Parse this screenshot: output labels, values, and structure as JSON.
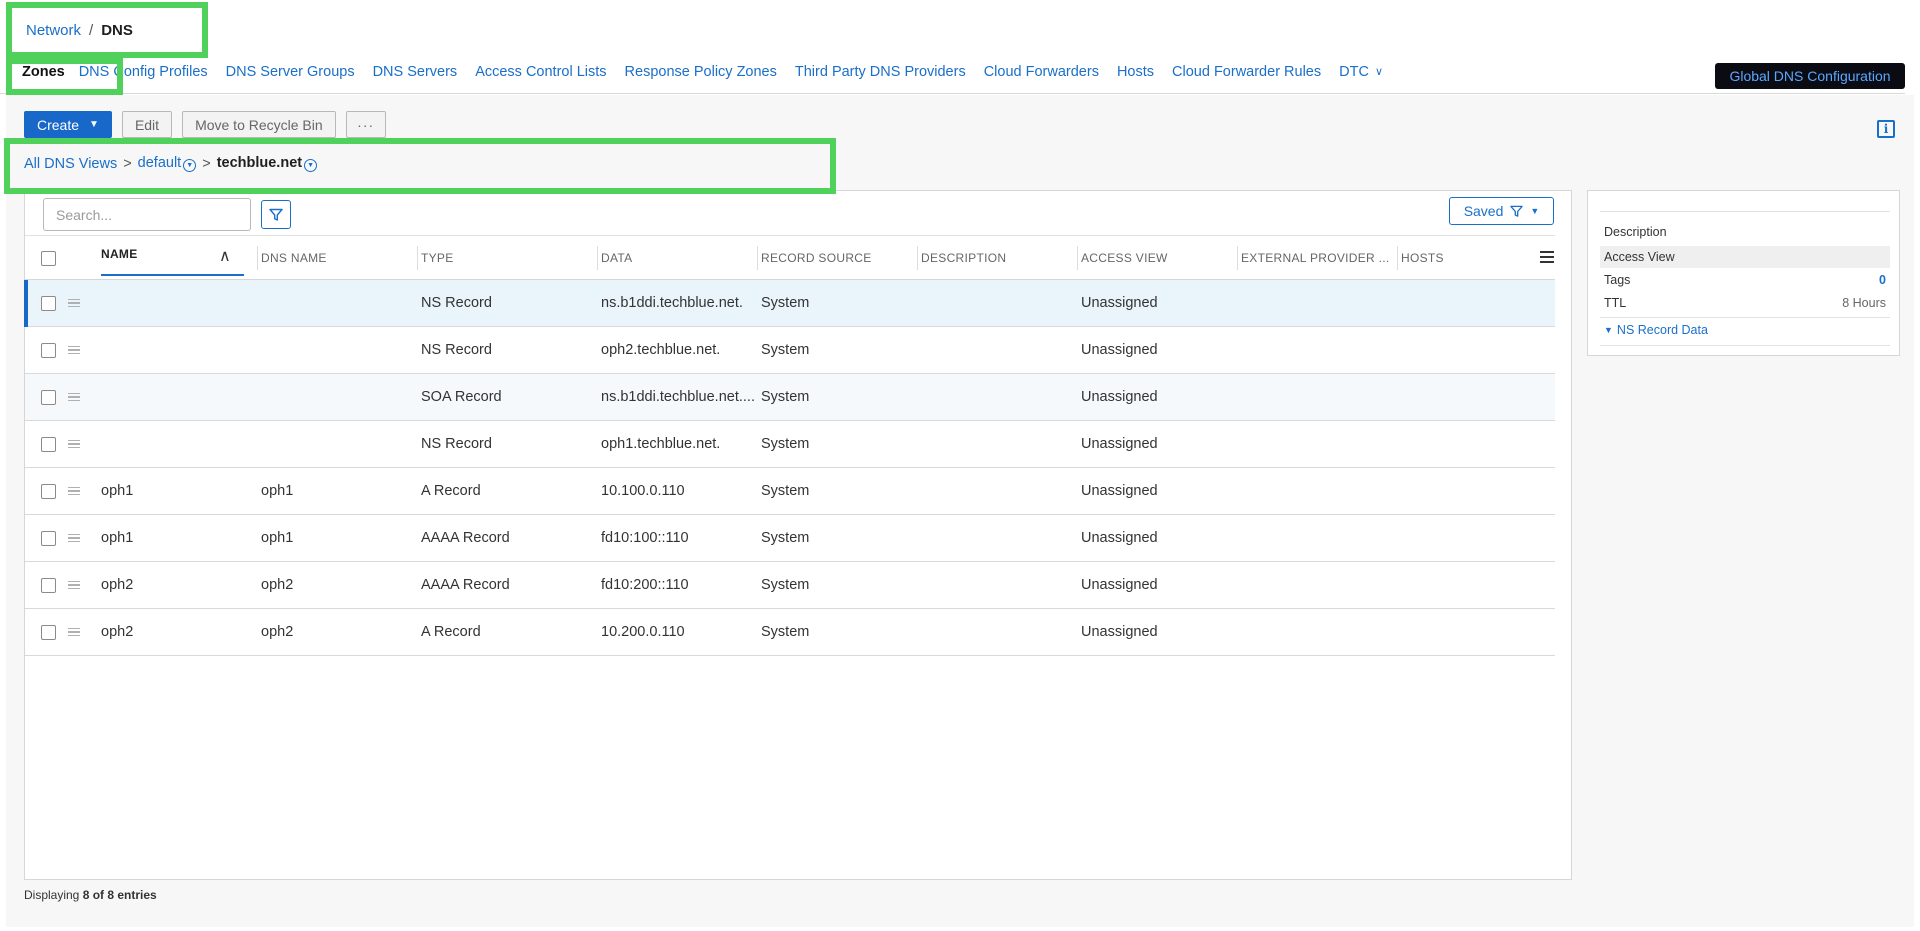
{
  "breadcrumb": {
    "parent": "Network",
    "separator": "/",
    "current": "DNS"
  },
  "tabs": [
    {
      "label": "Zones",
      "active": true
    },
    {
      "label": "DNS Config Profiles"
    },
    {
      "label": "DNS Server Groups"
    },
    {
      "label": "DNS Servers"
    },
    {
      "label": "Access Control Lists"
    },
    {
      "label": "Response Policy Zones"
    },
    {
      "label": "Third Party DNS Providers"
    },
    {
      "label": "Cloud Forwarders"
    },
    {
      "label": "Hosts"
    },
    {
      "label": "Cloud Forwarder Rules"
    },
    {
      "label": "DTC"
    }
  ],
  "global_button": "Global DNS Configuration",
  "toolbar": {
    "create": "Create",
    "edit": "Edit",
    "recycle": "Move to Recycle Bin",
    "more": "···"
  },
  "view_crumb": {
    "all": "All DNS Views",
    "gt": ">",
    "view": "default",
    "zone": "techblue.net"
  },
  "search": {
    "placeholder": "Search..."
  },
  "saved_button": "Saved",
  "columns": [
    "NAME",
    "DNS NAME",
    "TYPE",
    "DATA",
    "RECORD SOURCE",
    "DESCRIPTION",
    "ACCESS VIEW",
    "EXTERNAL PROVIDER ...",
    "HOSTS"
  ],
  "rows": [
    {
      "name": "",
      "dns_name": "",
      "type": "NS Record",
      "data": "ns.b1ddi.techblue.net.",
      "source": "System",
      "description": "",
      "access_view": "Unassigned"
    },
    {
      "name": "",
      "dns_name": "",
      "type": "NS Record",
      "data": "oph2.techblue.net.",
      "source": "System",
      "description": "",
      "access_view": "Unassigned"
    },
    {
      "name": "",
      "dns_name": "",
      "type": "SOA Record",
      "data": "ns.b1ddi.techblue.net....",
      "source": "System",
      "description": "",
      "access_view": "Unassigned"
    },
    {
      "name": "",
      "dns_name": "",
      "type": "NS Record",
      "data": "oph1.techblue.net.",
      "source": "System",
      "description": "",
      "access_view": "Unassigned"
    },
    {
      "name": "oph1",
      "dns_name": "oph1",
      "type": "A Record",
      "data": "10.100.0.110",
      "source": "System",
      "description": "",
      "access_view": "Unassigned"
    },
    {
      "name": "oph1",
      "dns_name": "oph1",
      "type": "AAAA Record",
      "data": "fd10:100::110",
      "source": "System",
      "description": "",
      "access_view": "Unassigned"
    },
    {
      "name": "oph2",
      "dns_name": "oph2",
      "type": "AAAA Record",
      "data": "fd10:200::110",
      "source": "System",
      "description": "",
      "access_view": "Unassigned"
    },
    {
      "name": "oph2",
      "dns_name": "oph2",
      "type": "A Record",
      "data": "10.200.0.110",
      "source": "System",
      "description": "",
      "access_view": "Unassigned"
    }
  ],
  "details": {
    "description_label": "Description",
    "access_view_label": "Access View",
    "tags_label": "Tags",
    "tags_value": "0",
    "ttl_label": "TTL",
    "ttl_value": "8 Hours",
    "section": "NS Record Data"
  },
  "footer": {
    "prefix": "Displaying",
    "count": "8 of 8 entries"
  },
  "colors": {
    "accent": "#1a6fc9",
    "highlight": "#4fd15b",
    "selected_row": "#eaf4fb"
  }
}
